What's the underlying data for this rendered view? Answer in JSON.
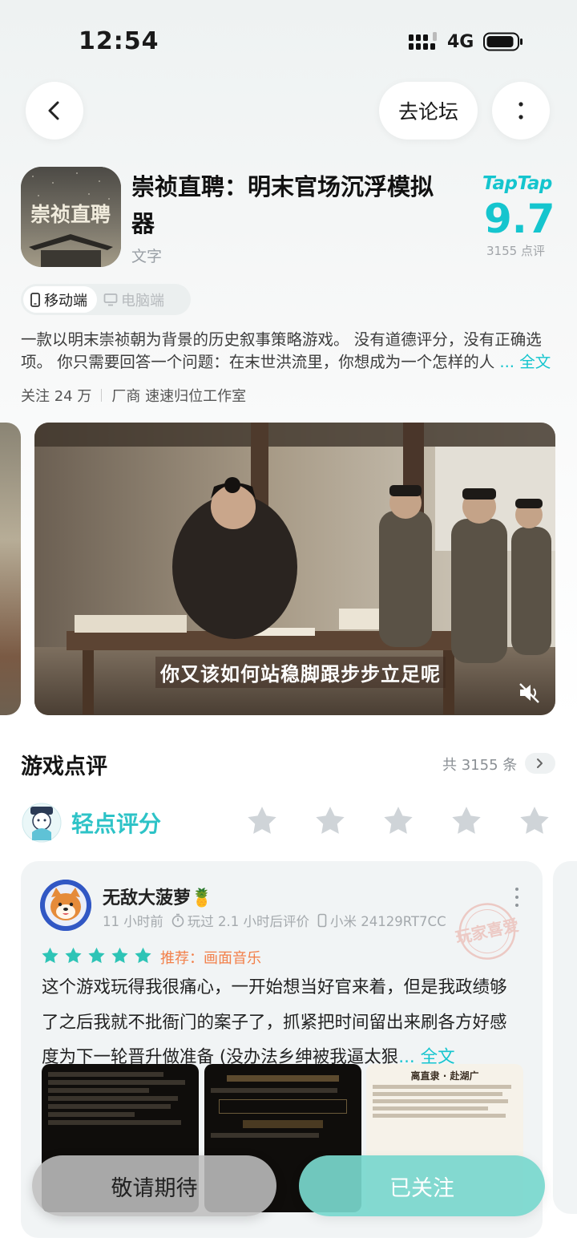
{
  "status_bar": {
    "time": "12:54",
    "network": "4G"
  },
  "header": {
    "forum_label": "去论坛"
  },
  "app": {
    "title": "崇祯直聘：明末官场沉浮模拟器",
    "icon_text": "崇祯直聘",
    "category": "文字",
    "tap_logo": "TapTap",
    "score": "9.7",
    "rating_count": "3155 点评"
  },
  "platform_tabs": [
    {
      "label": "移动端",
      "active": true
    },
    {
      "label": "电脑端",
      "active": false
    }
  ],
  "description": {
    "text": "一款以明末崇祯朝为背景的历史叙事策略游戏。 没有道德评分，没有正确选项。 你只需要回答一个问题：在末世洪流里，你想成为一个怎样的人",
    "more": "... 全文"
  },
  "meta": {
    "followers": "关注 24 万",
    "vendor": "厂商 速速归位工作室"
  },
  "media": {
    "subtitle": "你又该如何站稳脚跟步步立足呢"
  },
  "reviews_section": {
    "title": "游戏点评",
    "total": "共 3155 条",
    "tap_rate_label": "轻点评分"
  },
  "review": {
    "name": "无敌大菠萝🍍",
    "time": "11 小时前",
    "play_time": "玩过 2.1 小时后评价",
    "device": "小米 24129RT7CC",
    "stamp": "玩家喜爱",
    "rating": 5,
    "recommend": "推荐：画面音乐",
    "text": "这个游戏玩得我很痛心，一开始想当好官来着，但是我政绩够了之后我就不批衙门的案子了，抓紧把时间留出来刷各方好感度为下一轮晋升做准备 (没办法乡绅被我逼太狠",
    "more": "... 全文",
    "shot_title": "离直隶 · 赴湖广"
  },
  "bottom": {
    "left_label": "敬请期待",
    "right_label": "已关注"
  },
  "colors": {
    "accent": "#15c5ce",
    "star": "#2ec4b6",
    "recommend": "#f2804a"
  }
}
